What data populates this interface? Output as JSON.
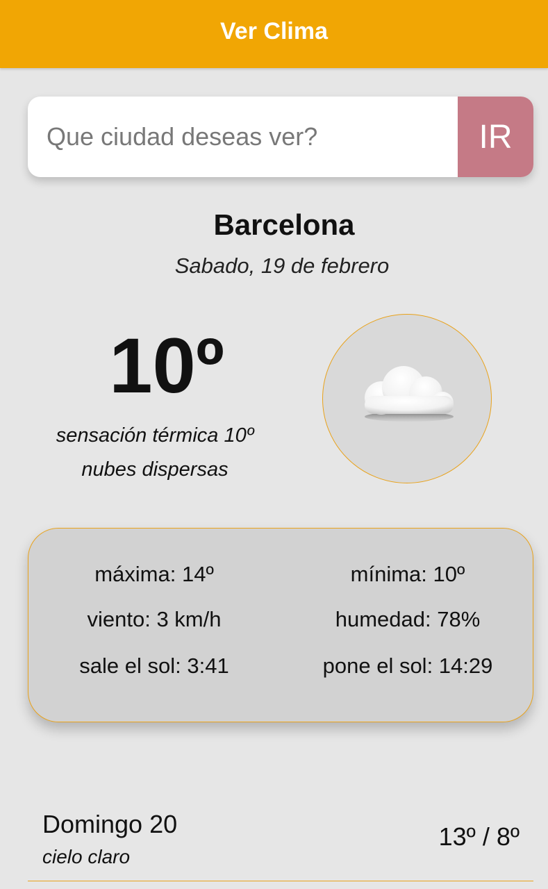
{
  "app": {
    "title": "Ver Clima"
  },
  "search": {
    "placeholder": "Que ciudad deseas ver?",
    "value": "",
    "button_label": "IR"
  },
  "current": {
    "city": "Barcelona",
    "date": "Sabado, 19 de febrero",
    "temperature": "10º",
    "feels_like": "sensación térmica 10º",
    "description": "nubes dispersas",
    "icon": "scattered-clouds-icon"
  },
  "details": {
    "max": "máxima: 14º",
    "min": "mínima: 10º",
    "wind": "viento: 3 km/h",
    "humidity": "humedad: 78%",
    "sunrise": "sale el sol: 3:41",
    "sunset": "pone el sol: 14:29"
  },
  "forecast": [
    {
      "day": "Domingo 20",
      "description": "cielo claro",
      "temps": "13º / 8º"
    }
  ],
  "colors": {
    "accent": "#f1a604",
    "button": "#c57a86",
    "background": "#e6e6e6",
    "card": "#d2d2d2"
  }
}
